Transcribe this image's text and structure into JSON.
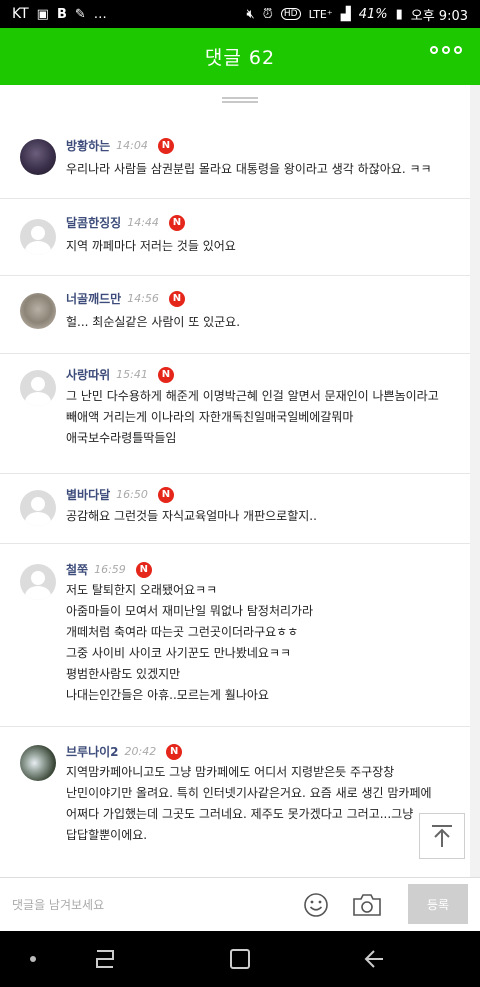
{
  "status_bar": {
    "carrier": "KT",
    "lte": "LTE⁺",
    "battery": "41%",
    "time": "오후 9:03"
  },
  "header": {
    "title": "댓글 62"
  },
  "comments": [
    {
      "author": "방황하는",
      "time": "14:04",
      "badge": "N",
      "avatar": "photo",
      "lines": [
        "우리나라 사람들 삼권분립 몰라요 대통령을 왕이라고 생각 하잖아요. ㅋㅋ"
      ]
    },
    {
      "author": "달콤한징징",
      "time": "14:44",
      "badge": "N",
      "avatar": "default",
      "lines": [
        "지역 까페마다 저러는 것들 있어요"
      ]
    },
    {
      "author": "너골깨드만",
      "time": "14:56",
      "badge": "N",
      "avatar": "photo",
      "lines": [
        "헐... 최순실같은 사람이 또 있군요."
      ]
    },
    {
      "author": "사랑따위",
      "time": "15:41",
      "badge": "N",
      "avatar": "default",
      "lines": [
        "그 난민 다수용하게 해준게 이명박근혜 인걸 알면서 문재인이 나쁜놈이라고",
        "빼애액 거리는게 이나라의 자한개독친일매국일베에갈뭐마",
        "애국보수라령틀딱들임"
      ]
    },
    {
      "author": "별바다달",
      "time": "16:50",
      "badge": "N",
      "avatar": "default",
      "lines": [
        "공감해요 그런것들 자식교육얼마나 개판으로할지.."
      ]
    },
    {
      "author": "철쭉",
      "time": "16:59",
      "badge": "N",
      "avatar": "default",
      "lines": [
        "저도 탈퇴한지 오래됐어요ㅋㅋ",
        "아줌마들이 모여서 재미난일 뭐없나 탐정처리가라",
        "개떼처럼 축여라 따는곳 그런곳이더라구요ㅎㅎ",
        "그중 사이비 사이코 사기꾼도 만나봤네요ㅋㅋ",
        "평범한사람도 있겠지만",
        "나대는인간들은 아휴..모르는게 훨나아요"
      ]
    },
    {
      "author": "브루나이2",
      "time": "20:42",
      "badge": "N",
      "avatar": "photo",
      "lines": [
        "지역맘카페아니고도 그냥 맘카페에도 어디서 지령받은듯 주구장창",
        "난민이야기만 올려요. 특히 인터넷기사같은거요. 요즘 새로 생긴 맘카페에",
        "어쩌다 가입했는데 그곳도 그러네요. 제주도 못가겠다고 그러고...그냥",
        "답답할뿐이에요."
      ]
    }
  ],
  "input": {
    "placeholder": "댓글을 남겨보세요",
    "submit_label": "등록"
  },
  "icons": {
    "header_more": "more-dots-icon",
    "scroll_top": "arrow-up-icon",
    "emoji": "smiley-icon",
    "camera": "camera-icon",
    "nav_recent": "recent-apps-icon",
    "nav_home": "home-icon",
    "nav_back": "back-icon"
  },
  "colors": {
    "brand_green": "#1ec800",
    "badge_red": "#e5261b",
    "author_blue": "#3d4c7a"
  }
}
